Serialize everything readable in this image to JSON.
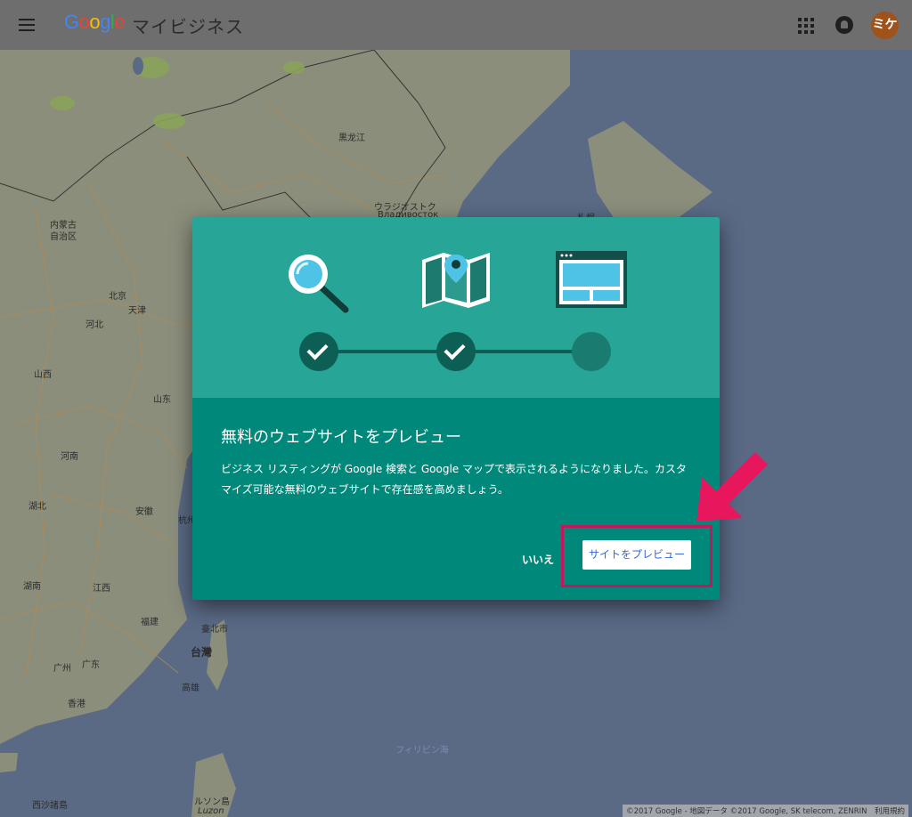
{
  "header": {
    "logo_letters": [
      "G",
      "o",
      "o",
      "g",
      "l",
      "e"
    ],
    "product_name": "マイビジネス",
    "avatar_text": "ミケ",
    "icons": [
      "menu-icon",
      "apps-icon",
      "notifications-icon",
      "account-avatar"
    ]
  },
  "map": {
    "labels": {
      "heilongjiang": "黒龙江",
      "vladivostok_jp": "ウラジオストク",
      "vladivostok_ru": "Владивосток",
      "inner_mongolia_1": "内蒙古",
      "inner_mongolia_2": "自治区",
      "beijing": "北京",
      "tianjin": "天津",
      "hebei": "河北",
      "shanxi": "山西",
      "shandong": "山东",
      "henan": "河南",
      "hubei": "湖北",
      "anhui": "安徽",
      "hangzhou": "杭州",
      "hunan": "湖南",
      "jiangxi": "江西",
      "fujian": "福建",
      "guangzhou": "广州",
      "guangdong": "广东",
      "hongkong": "香港",
      "taipei": "臺北市",
      "taiwan": "台灣",
      "kaohsiung": "高雄",
      "philippine_sea": "フィリピン海",
      "luzon_jp": "ルソン島",
      "luzon_en": "Luzon",
      "xisha": "西沙諸島",
      "sapporo": "札幌"
    },
    "attribution": "©2017 Google - 地図データ ©2017 Google, SK telecom, ZENRIN　利用規約"
  },
  "dialog": {
    "steps": [
      {
        "name": "search",
        "icon": "magnifier-icon",
        "status": "done"
      },
      {
        "name": "maps",
        "icon": "map-pin-icon",
        "status": "done"
      },
      {
        "name": "website",
        "icon": "website-icon",
        "status": "current"
      }
    ],
    "title": "無料のウェブサイトをプレビュー",
    "body": "ビジネス リスティングが Google 検索と Google マップで表示されるようになりました。カスタマイズ可能な無料のウェブサイトで存在感を高めましょう。",
    "no_label": "いいえ",
    "preview_label": "サイトをプレビュー"
  },
  "colors": {
    "dialog_top": "#27a596",
    "dialog_bottom": "#00897b",
    "annotation": "#e8175d"
  }
}
